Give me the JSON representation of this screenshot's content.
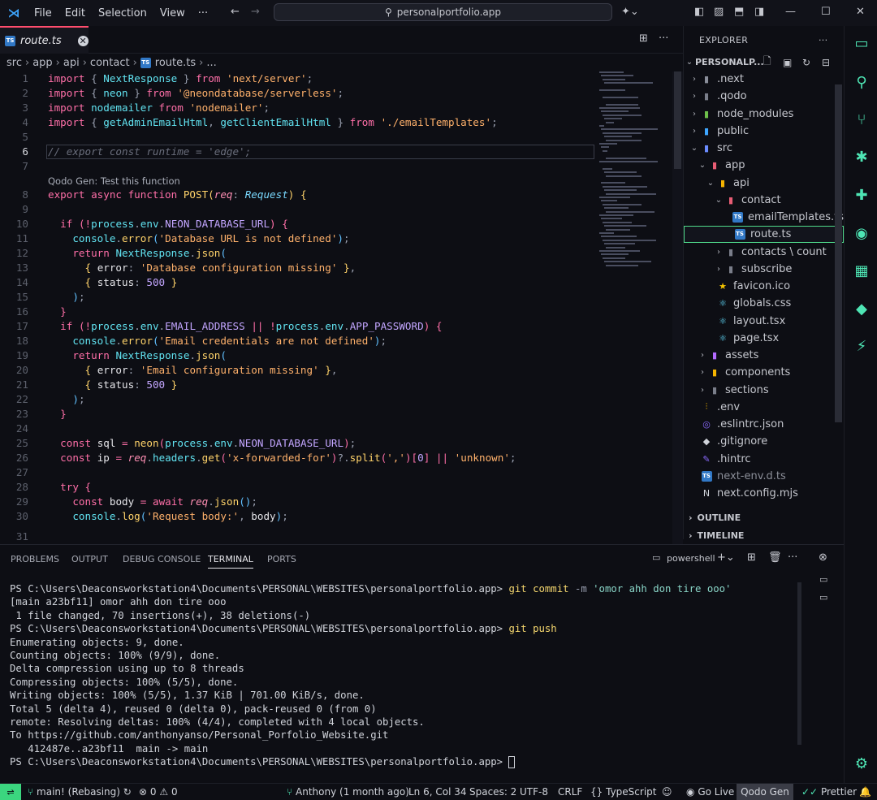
{
  "titlebar": {
    "menu": [
      "File",
      "Edit",
      "Selection",
      "View",
      "···"
    ],
    "search": "personalportfolio.app"
  },
  "tab": {
    "label": "route.ts"
  },
  "breadcrumb": [
    "src",
    "app",
    "api",
    "contact",
    "route.ts",
    "..."
  ],
  "editor": {
    "codelens": "Qodo Gen: Test this function",
    "line_numbers": [
      "1",
      "2",
      "3",
      "4",
      "5",
      "6",
      "7",
      "8",
      "9",
      "10",
      "11",
      "12",
      "13",
      "14",
      "15",
      "16",
      "17",
      "18",
      "19",
      "20",
      "21",
      "22",
      "23",
      "24",
      "25",
      "26",
      "27",
      "28",
      "29",
      "30",
      "31"
    ]
  },
  "explorer": {
    "title": "EXPLORER",
    "root": "PERSONALP...",
    "items": [
      {
        "label": ".next",
        "depth": 1,
        "chev": ">",
        "icon": "next-folder"
      },
      {
        "label": ".qodo",
        "depth": 1,
        "chev": ">",
        "icon": "folder"
      },
      {
        "label": "node_modules",
        "depth": 1,
        "chev": ">",
        "icon": "node-folder"
      },
      {
        "label": "public",
        "depth": 1,
        "chev": ">",
        "icon": "public-folder"
      },
      {
        "label": "src",
        "depth": 1,
        "chev": "v",
        "icon": "src-folder"
      },
      {
        "label": "app",
        "depth": 2,
        "chev": "v",
        "icon": "app-folder"
      },
      {
        "label": "api",
        "depth": 3,
        "chev": "v",
        "icon": "api-folder"
      },
      {
        "label": "contact",
        "depth": 4,
        "chev": "v",
        "icon": "contact-folder"
      },
      {
        "label": "emailTemplates.ts",
        "depth": 5,
        "chev": "",
        "icon": "ts"
      },
      {
        "label": "route.ts",
        "depth": 5,
        "chev": "",
        "icon": "ts"
      },
      {
        "label": "contacts \\ count",
        "depth": 4,
        "chev": ">",
        "icon": "folder"
      },
      {
        "label": "subscribe",
        "depth": 4,
        "chev": ">",
        "icon": "folder"
      },
      {
        "label": "favicon.ico",
        "depth": 3,
        "chev": "",
        "icon": "star"
      },
      {
        "label": "globals.css",
        "depth": 3,
        "chev": "",
        "icon": "react"
      },
      {
        "label": "layout.tsx",
        "depth": 3,
        "chev": "",
        "icon": "react"
      },
      {
        "label": "page.tsx",
        "depth": 3,
        "chev": "",
        "icon": "react"
      },
      {
        "label": "assets",
        "depth": 2,
        "chev": ">",
        "icon": "assets-folder"
      },
      {
        "label": "components",
        "depth": 2,
        "chev": ">",
        "icon": "components-folder"
      },
      {
        "label": "sections",
        "depth": 2,
        "chev": ">",
        "icon": "folder"
      },
      {
        "label": ".env",
        "depth": 1,
        "chev": "",
        "icon": "env"
      },
      {
        "label": ".eslintrc.json",
        "depth": 1,
        "chev": "",
        "icon": "eslint"
      },
      {
        "label": ".gitignore",
        "depth": 1,
        "chev": "",
        "icon": "git"
      },
      {
        "label": ".hintrc",
        "depth": 1,
        "chev": "",
        "icon": "hint"
      },
      {
        "label": "next-env.d.ts",
        "depth": 1,
        "chev": "",
        "icon": "ts"
      },
      {
        "label": "next.config.mjs",
        "depth": 1,
        "chev": "",
        "icon": "next"
      }
    ],
    "outline": "OUTLINE",
    "timeline": "TIMELINE"
  },
  "panel": {
    "tabs": [
      "PROBLEMS",
      "OUTPUT",
      "DEBUG CONSOLE",
      "TERMINAL",
      "PORTS"
    ],
    "shell": "powershell",
    "terminal": {
      "prompt": "PS C:\\Users\\Deaconsworkstation4\\Documents\\PERSONAL\\WEBSITES\\personalportfolio.app>",
      "commit_cmd": "git commit",
      "commit_flag": "-m",
      "commit_msg": "'omor ahh don tire ooo'",
      "l2": "[main a23bf11] omor ahh don tire ooo",
      "l3": " 1 file changed, 70 insertions(+), 38 deletions(-)",
      "push_cmd": "git push",
      "l5": "Enumerating objects: 9, done.",
      "l6": "Counting objects: 100% (9/9), done.",
      "l7": "Delta compression using up to 8 threads",
      "l8": "Compressing objects: 100% (5/5), done.",
      "l9": "Writing objects: 100% (5/5), 1.37 KiB | 701.00 KiB/s, done.",
      "l10": "Total 5 (delta 4), reused 0 (delta 0), pack-reused 0 (from 0)",
      "l11": "remote: Resolving deltas: 100% (4/4), completed with 4 local objects.",
      "l12": "To https://github.com/anthonyanso/Personal_Porfolio_Website.git",
      "l13": "   412487e..a23bf11  main -> main"
    }
  },
  "statusbar": {
    "branch": "main! (Rebasing)",
    "errors": "0",
    "warnings": "0",
    "blame": "Anthony (1 month ago)",
    "position": "Ln 6, Col 34",
    "spaces": "Spaces: 2",
    "encoding": "UTF-8",
    "eol": "CRLF",
    "language": "TypeScript",
    "golive": "Go Live",
    "qodo": "Qodo Gen",
    "prettier": "Prettier"
  },
  "colors": {
    "accent": "#4ee5b4",
    "tab_border": "#ff4d6d",
    "remote": "#3bd67f"
  }
}
